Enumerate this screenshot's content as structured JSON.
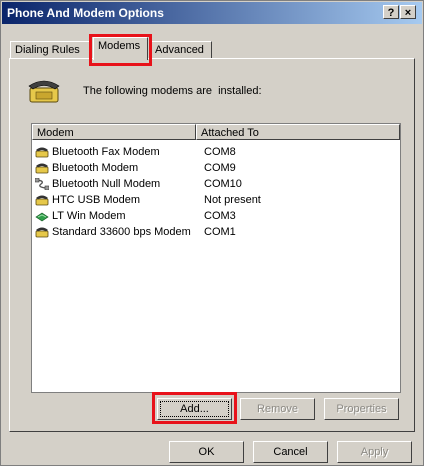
{
  "window": {
    "title": "Phone And Modem Options"
  },
  "titlebar_buttons": {
    "help": "?",
    "close": "×"
  },
  "tabs": [
    "Dialing Rules",
    "Modems",
    "Advanced"
  ],
  "intro": {
    "text": "The following modems are  installed:"
  },
  "table": {
    "headers": [
      "Modem",
      "Attached To"
    ],
    "rows": [
      {
        "icon": "phone-modem-icon",
        "modem": "Bluetooth Fax Modem",
        "port": "COM8"
      },
      {
        "icon": "phone-modem-icon",
        "modem": "Bluetooth Modem",
        "port": "COM9"
      },
      {
        "icon": "null-modem-cable-icon",
        "modem": "Bluetooth Null Modem",
        "port": "COM10"
      },
      {
        "icon": "phone-modem-icon",
        "modem": "HTC USB Modem",
        "port": "Not present"
      },
      {
        "icon": "green-modem-icon",
        "modem": "LT Win Modem",
        "port": "COM3"
      },
      {
        "icon": "phone-modem-icon",
        "modem": "Standard 33600 bps Modem",
        "port": "COM1"
      }
    ]
  },
  "buttons": {
    "add": "Add...",
    "remove": "Remove",
    "properties": "Properties",
    "ok": "OK",
    "cancel": "Cancel",
    "apply": "Apply"
  },
  "colors": {
    "title_start": "#0a246a",
    "title_end": "#a6caf0",
    "highlight": "#e8121a",
    "face": "#d4d0c8"
  }
}
